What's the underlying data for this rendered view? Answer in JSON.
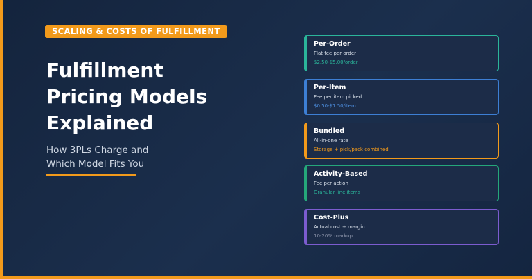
{
  "badge": "SCALING & COSTS OF FULFILLMENT",
  "title": {
    "line1": "Fulfillment",
    "line2": "Pricing Models",
    "line3": "Explained"
  },
  "subtitle": {
    "line1": "How 3PLs Charge and",
    "line2": "Which Model Fits You"
  },
  "colors": {
    "accent": "#f29a1b",
    "background": "#1b2f4d",
    "teal": "#2bb59a",
    "blue": "#3d7fd4",
    "orange": "#f29a1b",
    "green": "#25a77a",
    "purple": "#7c5ccf"
  },
  "cards": [
    {
      "title": "Per-Order",
      "description": "Flat fee per order",
      "detail": "$2.50-$5.00/order",
      "color": "#2bb59a",
      "detail_color": "#2bb59a"
    },
    {
      "title": "Per-Item",
      "description": "Fee per item picked",
      "detail": "$0.50-$1.50/item",
      "color": "#3d7fd4",
      "detail_color": "#4d8fe0"
    },
    {
      "title": "Bundled",
      "description": "All-in-one rate",
      "detail": "Storage + pick/pack combined",
      "color": "#f29a1b",
      "detail_color": "#f29a1b"
    },
    {
      "title": "Activity-Based",
      "description": "Fee per action",
      "detail": "Granular line items",
      "color": "#25a77a",
      "detail_color": "#2bb59a"
    },
    {
      "title": "Cost-Plus",
      "description": "Actual cost + margin",
      "detail": "10-20% markup",
      "color": "#7c5ccf",
      "detail_color": "#8c94aa"
    }
  ]
}
